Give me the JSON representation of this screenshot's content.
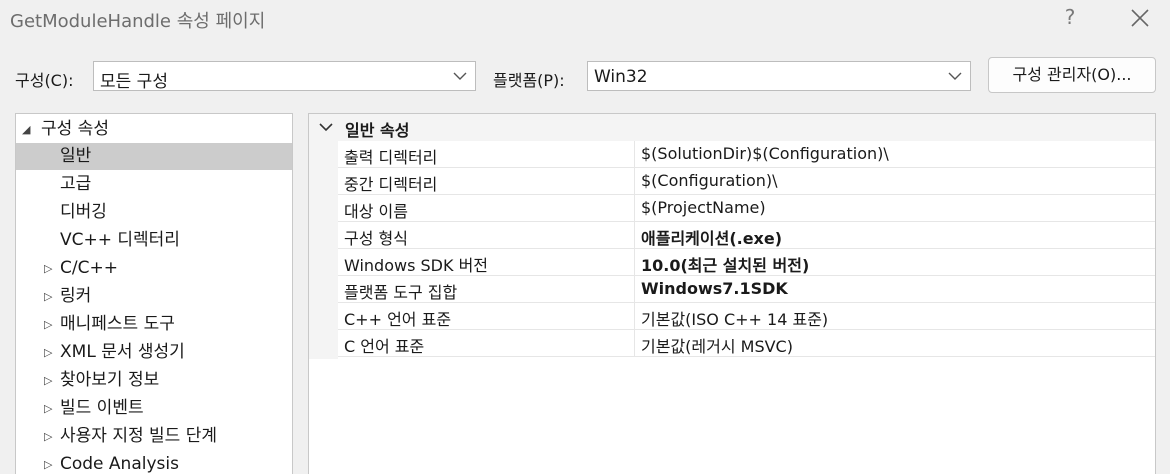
{
  "window": {
    "title": "GetModuleHandle 속성 페이지",
    "help_glyph": "?",
    "close_icon": "close-icon"
  },
  "toolbar": {
    "config_label": "구성(C):",
    "config_value": "모든 구성",
    "platform_label": "플랫폼(P):",
    "platform_value": "Win32",
    "manager_button": "구성 관리자(O)..."
  },
  "tree": {
    "root_label": "구성 속성",
    "children": [
      {
        "label": "일반",
        "selected": true
      },
      {
        "label": "고급"
      },
      {
        "label": "디버깅"
      },
      {
        "label": "VC++ 디렉터리"
      },
      {
        "label": "C/C++",
        "expandable": true
      },
      {
        "label": "링커",
        "expandable": true
      },
      {
        "label": "매니페스트 도구",
        "expandable": true
      },
      {
        "label": "XML 문서 생성기",
        "expandable": true
      },
      {
        "label": "찾아보기 정보",
        "expandable": true
      },
      {
        "label": "빌드 이벤트",
        "expandable": true
      },
      {
        "label": "사용자 지정 빌드 단계",
        "expandable": true
      },
      {
        "label": "Code Analysis",
        "expandable": true
      }
    ]
  },
  "grid": {
    "section_title": "일반 속성",
    "rows": [
      {
        "name": "출력 디렉터리",
        "value": "$(SolutionDir)$(Configuration)\\",
        "bold": false
      },
      {
        "name": "중간 디렉터리",
        "value": "$(Configuration)\\",
        "bold": false
      },
      {
        "name": "대상 이름",
        "value": "$(ProjectName)",
        "bold": false
      },
      {
        "name": "구성 형식",
        "value": "애플리케이션(.exe)",
        "bold": true
      },
      {
        "name": "Windows SDK 버전",
        "value": "10.0(최근 설치된 버전)",
        "bold": true
      },
      {
        "name": "플랫폼 도구 집합",
        "value": "Windows7.1SDK",
        "bold": true
      },
      {
        "name": "C++ 언어 표준",
        "value": "기본값(ISO C++ 14 표준)",
        "bold": false
      },
      {
        "name": "C 언어 표준",
        "value": "기본값(레거시 MSVC)",
        "bold": false
      }
    ]
  },
  "colors": {
    "selection": "#cccccc",
    "background": "#f0f0f0"
  }
}
